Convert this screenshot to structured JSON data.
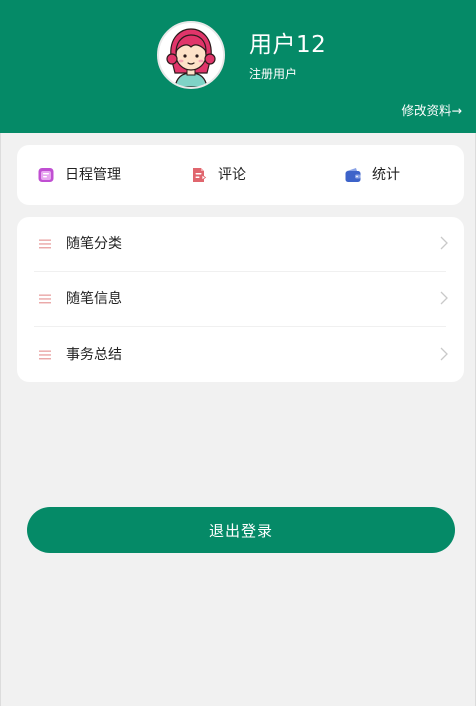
{
  "header": {
    "background_color": "#058a67",
    "avatar_icon": "cartoon-girl-avatar",
    "username": "用户12",
    "role": "注册用户",
    "edit_profile": "修改资料→"
  },
  "quick_actions": [
    {
      "label": "日程管理",
      "icon": "calendar-icon",
      "color": "#c04fd2"
    },
    {
      "label": "评论",
      "icon": "document-edit-icon",
      "color": "#e0666e"
    },
    {
      "label": "统计",
      "icon": "wallet-icon",
      "color": "#3d63c9"
    }
  ],
  "menu": {
    "items": [
      {
        "label": "随笔分类",
        "icon": "menu-lines-icon"
      },
      {
        "label": "随笔信息",
        "icon": "menu-lines-icon"
      },
      {
        "label": "事务总结",
        "icon": "menu-lines-icon"
      }
    ],
    "icon_color": "#e8a0a0",
    "chevron_color": "#c9c9c9"
  },
  "logout": {
    "label": "退出登录",
    "color": "#058a67"
  }
}
